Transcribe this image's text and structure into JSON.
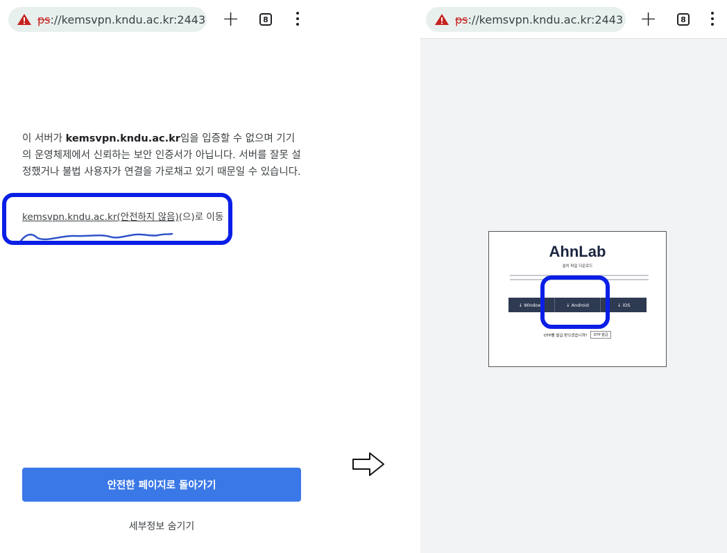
{
  "browser": {
    "url_prefix": "ps",
    "url_rest": "://kemsvpn.kndu.ac.kr:2443",
    "new_tab_icon": "plus-icon",
    "tab_count": "8",
    "menu_icon": "kebab-icon"
  },
  "warning_page": {
    "message_part1": "이 서버가 ",
    "message_host": "kemsvpn.kndu.ac.kr",
    "message_part2": "임을 입증할 수 없으며 기기의 운영체제에서 신뢰하는 보안 인증서가 아닙니다. 서버를 잘못 설정했거나 불법 사용자가 연결을 가로채고 있기 때문일 수 있습니다.",
    "proceed_link_underlined": "kemsvpn.kndu.ac.kr(안전하지 않음)",
    "proceed_link_suffix": "(으)로 이동",
    "back_button": "안전한 페이지로 돌아가기",
    "hide_details": "세부정보 숨기기"
  },
  "download_page": {
    "logo": "AhnLab",
    "subtitle": "설치 파일 다운로드",
    "buttons": [
      "↓ Windows",
      "↓ Android",
      "↓ iOS"
    ],
    "otp_question": "OTP를 발급 받으셨습니까?",
    "otp_button": "OTP 발급"
  },
  "colors": {
    "highlight": "#0a1fe6",
    "primary_button": "#3b78e7",
    "warning_red": "#c5221f"
  }
}
